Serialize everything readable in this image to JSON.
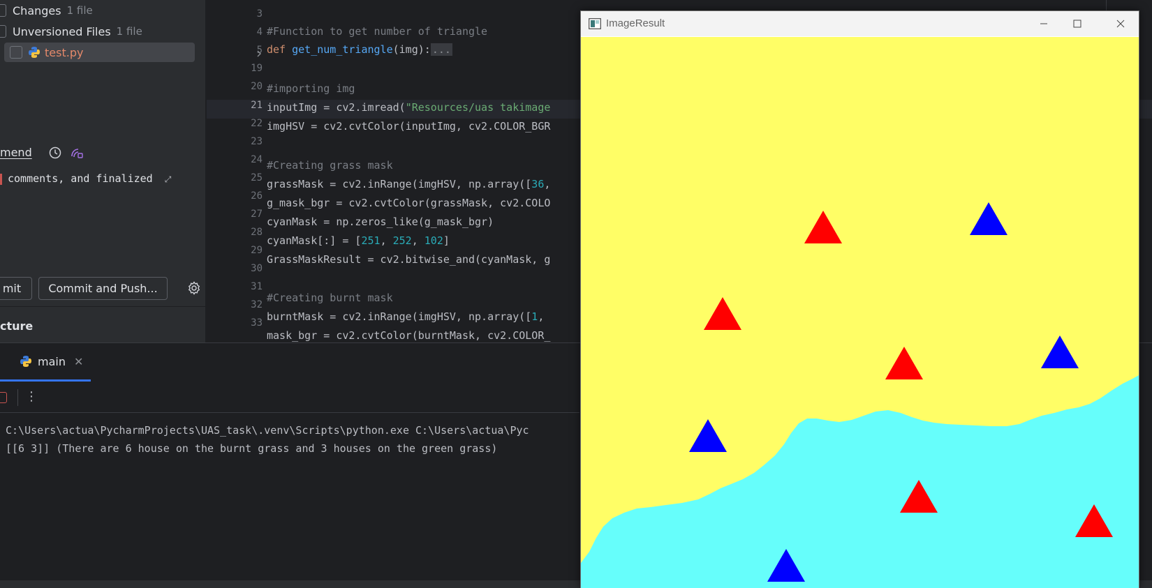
{
  "commit_panel": {
    "changes": {
      "label": "Changes",
      "count": "1 file"
    },
    "unversioned": {
      "label": "Unversioned Files",
      "count": "1 file"
    },
    "file": {
      "name": "test.py"
    },
    "amend_label": "mend",
    "commit_message": "comments, and finalized",
    "commit_button": "mit",
    "commit_push_button": "Commit and Push...",
    "structure_label": "cture"
  },
  "editor": {
    "lines": [
      {
        "n": "3",
        "current": false
      },
      {
        "n": "4",
        "current": false
      },
      {
        "n": "5",
        "current": false
      },
      {
        "n": "19",
        "current": false
      },
      {
        "n": "20",
        "current": false
      },
      {
        "n": "21",
        "current": true
      },
      {
        "n": "22",
        "current": false
      },
      {
        "n": "23",
        "current": false
      },
      {
        "n": "24",
        "current": false
      },
      {
        "n": "25",
        "current": false
      },
      {
        "n": "26",
        "current": false
      },
      {
        "n": "27",
        "current": false
      },
      {
        "n": "28",
        "current": false
      },
      {
        "n": "29",
        "current": false
      },
      {
        "n": "30",
        "current": false
      },
      {
        "n": "31",
        "current": false
      },
      {
        "n": "32",
        "current": false
      },
      {
        "n": "33",
        "current": false
      }
    ],
    "code": {
      "l4": "#Function to get number of triangle",
      "l5_kw": "def ",
      "l5_fn": "get_num_triangle",
      "l5_args": "(img):",
      "l5_fold": "...",
      "l20": "#importing img",
      "l21_a": "inputImg = cv2.imread(",
      "l21_str": "\"Resources/uas takimage",
      "l22": "imgHSV = cv2.cvtColor(inputImg, cv2.COLOR_BGR",
      "l24": "#Creating grass mask",
      "l25_a": "grassMask = cv2.inRange(imgHSV, np.array([",
      "l25_num": "36",
      "l25_b": ",",
      "l26": "g_mask_bgr = cv2.cvtColor(grassMask, cv2.COLO",
      "l27": "cyanMask = np.zeros_like(g_mask_bgr)",
      "l28_a": "cyanMask[:] = [",
      "l28_n1": "251",
      "l28_sep1": ", ",
      "l28_n2": "252",
      "l28_sep2": ", ",
      "l28_n3": "102",
      "l28_b": "]",
      "l29": "GrassMaskResult = cv2.bitwise_and(cyanMask, g",
      "l31": "#Creating burnt mask",
      "l32_a": "burntMask = cv2.inRange(imgHSV, np.array([",
      "l32_num": "1",
      "l32_b": ",",
      "l33": "mask_bgr = cv2.cvtColor(burntMask, cv2.COLOR_"
    }
  },
  "run_panel": {
    "tab_label": "main",
    "console_line1": "C:\\Users\\actua\\PycharmProjects\\UAS_task\\.venv\\Scripts\\python.exe C:\\Users\\actua\\Pyc",
    "console_line2": "[[6 3]] (There are 6 house on the burnt grass and 3 houses on the green grass)"
  },
  "image_window": {
    "title": "ImageResult",
    "colors": {
      "burnt": "#fffe66",
      "grass": "#66fefb",
      "red": "#ff0000",
      "blue": "#0000ff"
    },
    "triangles": [
      {
        "color": "red",
        "region": "burnt"
      },
      {
        "color": "blue",
        "region": "burnt"
      },
      {
        "color": "red",
        "region": "burnt"
      },
      {
        "color": "red",
        "region": "burnt"
      },
      {
        "color": "blue",
        "region": "burnt"
      },
      {
        "color": "blue",
        "region": "burnt"
      },
      {
        "color": "red",
        "region": "grass"
      },
      {
        "color": "red",
        "region": "grass"
      },
      {
        "color": "blue",
        "region": "grass"
      }
    ]
  }
}
